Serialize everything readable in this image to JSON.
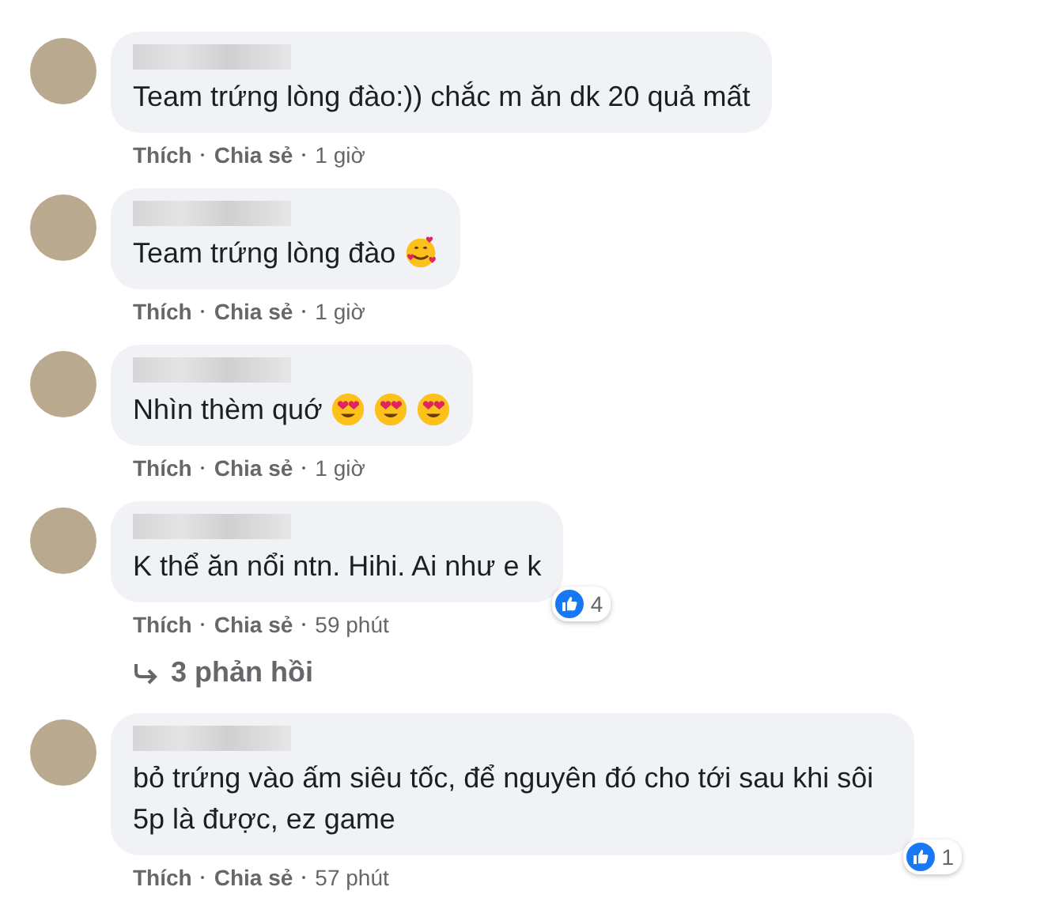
{
  "comments": [
    {
      "text": "Team trứng lòng đào:)) chắc m ăn dk 20 quả mất",
      "actions": [
        "Thích",
        "Chia sẻ"
      ],
      "time": "1 giờ"
    },
    {
      "text": "Team trứng lòng đào",
      "emojis": [
        {
          "kind": "hearts-face"
        }
      ],
      "actions": [
        "Thích",
        "Chia sẻ"
      ],
      "time": "1 giờ"
    },
    {
      "text": "Nhìn thèm quớ",
      "emojis": [
        {
          "kind": "heart-eyes"
        },
        {
          "kind": "heart-eyes"
        },
        {
          "kind": "heart-eyes"
        }
      ],
      "actions": [
        "Thích",
        "Chia sẻ"
      ],
      "time": "1 giờ"
    },
    {
      "text": "K thể ăn nổi ntn. Hihi. Ai như e k",
      "actions": [
        "Thích",
        "Chia sẻ"
      ],
      "time": "59 phút",
      "reaction": {
        "count": "4"
      },
      "replies": "3 phản hồi"
    },
    {
      "text": "bỏ trứng vào ấm siêu tốc, để nguyên đó cho tới sau khi sôi 5p là được, ez game",
      "actions": [
        "Thích",
        "Chia sẻ"
      ],
      "time": "57 phút",
      "reaction": {
        "count": "1"
      }
    }
  ]
}
